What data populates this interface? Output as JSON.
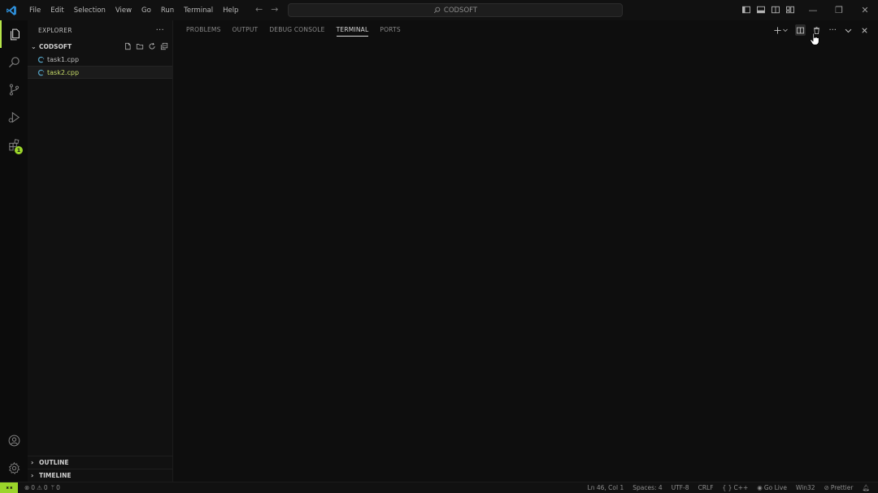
{
  "titlebar": {
    "menu": [
      "File",
      "Edit",
      "Selection",
      "View",
      "Go",
      "Run",
      "Terminal",
      "Help"
    ],
    "search_text": "CODSOFT"
  },
  "activity": {
    "extensions_badge": "1"
  },
  "sidebar": {
    "title": "EXPLORER",
    "more_label": "···",
    "folder": "CODSOFT",
    "files": [
      {
        "name": "task1.cpp",
        "selected": false
      },
      {
        "name": "task2.cpp",
        "selected": true
      }
    ],
    "outline": "OUTLINE",
    "timeline": "TIMELINE"
  },
  "panel": {
    "tabs": [
      "PROBLEMS",
      "OUTPUT",
      "DEBUG CONSOLE",
      "TERMINAL",
      "PORTS"
    ],
    "active_tab": "TERMINAL",
    "more_label": "···"
  },
  "statusbar": {
    "errors": "0",
    "warnings": "0",
    "ports": "0",
    "position": "Ln 46, Col 1",
    "spaces": "Spaces: 4",
    "encoding": "UTF-8",
    "eol": "CRLF",
    "language": "C++",
    "go_live": "Go Live",
    "platform": "Win32",
    "prettier": "Prettier"
  },
  "colors": {
    "accent": "#9bd52a",
    "cpp_icon": "#519aba",
    "selected_file": "#c7db68"
  }
}
